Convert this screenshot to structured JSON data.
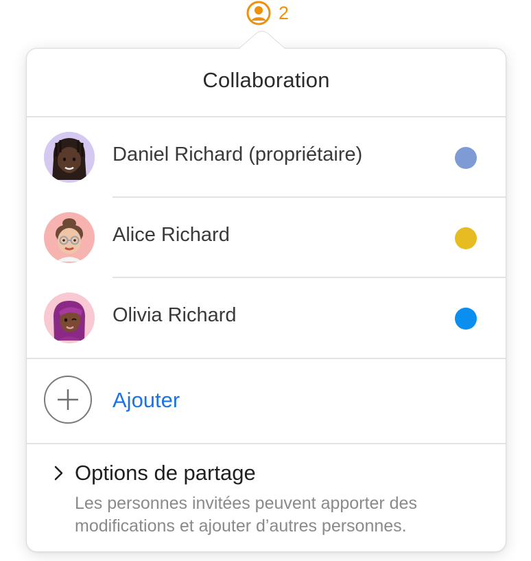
{
  "indicator": {
    "icon": "person-circle-icon",
    "count": "2",
    "color": "#f0900a"
  },
  "popover": {
    "title": "Collaboration"
  },
  "participants": [
    {
      "name": "Daniel Richard (propriétaire)",
      "avatar": "memoji-daniel",
      "color": "#7e9bd6"
    },
    {
      "name": "Alice Richard",
      "avatar": "memoji-alice",
      "color": "#e6bc22"
    },
    {
      "name": "Olivia Richard",
      "avatar": "memoji-olivia",
      "color": "#0a8ff0"
    }
  ],
  "add": {
    "label": "Ajouter",
    "icon": "plus-circle-icon"
  },
  "options": {
    "icon": "chevron-right-icon",
    "title": "Options de partage",
    "description": "Les personnes invitées peuvent apporter des modifications et ajouter d’autres personnes."
  }
}
